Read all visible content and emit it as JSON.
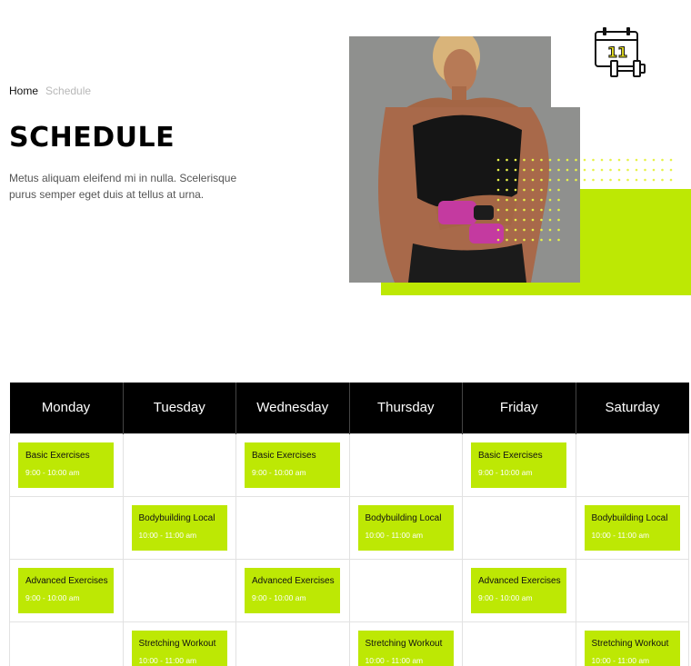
{
  "breadcrumb": {
    "home": "Home",
    "current": "Schedule"
  },
  "page": {
    "title": "SCHEDULE",
    "intro": "Metus aliquam eleifend mi in nulla. Scelerisque purus semper eget duis at tellus at urna."
  },
  "hero": {
    "icon": "calendar-dumbbell-icon",
    "accent_color": "#bde804"
  },
  "schedule": {
    "days": [
      "Monday",
      "Tuesday",
      "Wednesday",
      "Thursday",
      "Friday",
      "Saturday"
    ],
    "rows": [
      [
        {
          "name": "Basic Exercises",
          "time": "9:00 - 10:00 am"
        },
        null,
        {
          "name": "Basic Exercises",
          "time": "9:00 - 10:00 am"
        },
        null,
        {
          "name": "Basic Exercises",
          "time": "9:00 - 10:00 am"
        },
        null
      ],
      [
        null,
        {
          "name": "Bodybuilding Local",
          "time": "10:00 - 11:00 am"
        },
        null,
        {
          "name": "Bodybuilding Local",
          "time": "10:00 - 11:00 am"
        },
        null,
        {
          "name": "Bodybuilding Local",
          "time": "10:00 - 11:00 am"
        }
      ],
      [
        {
          "name": "Advanced Exercises",
          "time": "9:00 - 10:00 am"
        },
        null,
        {
          "name": "Advanced Exercises",
          "time": "9:00 - 10:00 am"
        },
        null,
        {
          "name": "Advanced Exercises",
          "time": "9:00 - 10:00 am"
        },
        null
      ],
      [
        null,
        {
          "name": "Stretching Workout",
          "time": "10:00 - 11:00 am"
        },
        null,
        {
          "name": "Stretching Workout",
          "time": "10:00 - 11:00 am"
        },
        null,
        {
          "name": "Stretching Workout",
          "time": "10:00 - 11:00 am"
        }
      ]
    ]
  }
}
